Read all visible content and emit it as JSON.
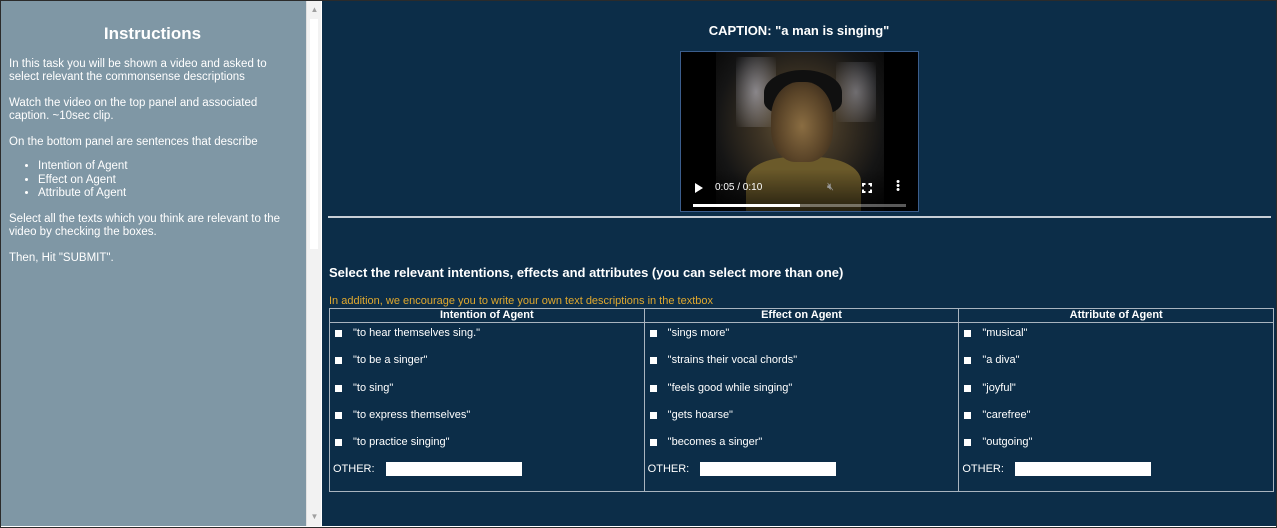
{
  "sidebar": {
    "title": "Instructions",
    "p1": "In this task you will be shown a video and asked to select relevant the commonsense descriptions",
    "p2": "Watch the video on the top panel and associated caption. ~10sec clip.",
    "p3": "On the bottom panel are sentences that describe",
    "list": [
      "Intention of Agent",
      "Effect on Agent",
      "Attribute of Agent"
    ],
    "p4": "Select all the texts which you think are relevant to the video by checking the boxes.",
    "p5": "Then, Hit \"SUBMIT\"."
  },
  "main": {
    "caption": "CAPTION: \"a man is singing\"",
    "video": {
      "time": "0:05 / 0:10",
      "progress": 0.5
    },
    "section_title": "Select the relevant intentions, effects and attributes (you can select more than one)",
    "encourage": "In addition, we encourage you to write your own text descriptions in the textbox",
    "other_label": "OTHER:",
    "columns": [
      {
        "header": "Intention of Agent",
        "options": [
          "\"to hear themselves sing.\"",
          "\"to be a singer\"",
          "\"to sing\"",
          "\"to express themselves\"",
          "\"to practice singing\""
        ]
      },
      {
        "header": "Effect on Agent",
        "options": [
          "\"sings more\"",
          "\"strains their vocal chords\"",
          "\"feels good while singing\"",
          "\"gets hoarse\"",
          "\"becomes a singer\""
        ]
      },
      {
        "header": "Attribute of Agent",
        "options": [
          "\"musical\"",
          "\"a diva\"",
          "\"joyful\"",
          "\"carefree\"",
          "\"outgoing\""
        ]
      }
    ]
  },
  "colors": {
    "sidebar_bg": "#7f97a5",
    "main_bg": "#0c2d48",
    "accent_text": "#e0a82e"
  }
}
